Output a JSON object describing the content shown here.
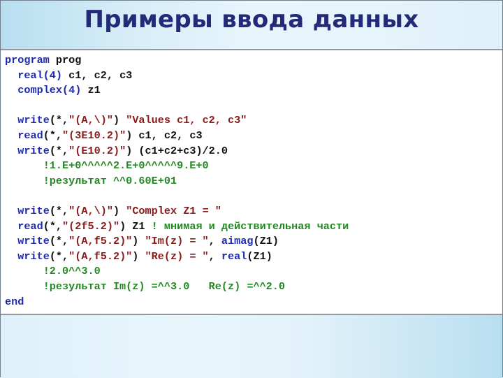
{
  "slide": {
    "title": "Примеры ввода данных"
  },
  "colors": {
    "title": "#232a78",
    "keyword": "#1f2ab0",
    "string": "#8b1a1a",
    "comment": "#238a23",
    "plain": "#111111"
  },
  "code": {
    "lines": [
      [
        {
          "t": "kw",
          "s": "program"
        },
        {
          "t": "plain",
          "s": " prog"
        }
      ],
      [
        {
          "t": "plain",
          "s": "  "
        },
        {
          "t": "kw",
          "s": "real(4)"
        },
        {
          "t": "plain",
          "s": " c1, c2, c3"
        }
      ],
      [
        {
          "t": "plain",
          "s": "  "
        },
        {
          "t": "kw",
          "s": "complex(4)"
        },
        {
          "t": "plain",
          "s": " z1"
        }
      ],
      [],
      [
        {
          "t": "plain",
          "s": "  "
        },
        {
          "t": "kw",
          "s": "write"
        },
        {
          "t": "plain",
          "s": "(*,"
        },
        {
          "t": "str",
          "s": "\"(A,\\)\""
        },
        {
          "t": "plain",
          "s": ") "
        },
        {
          "t": "str",
          "s": "\"Values c1, c2, c3\""
        }
      ],
      [
        {
          "t": "plain",
          "s": "  "
        },
        {
          "t": "kw",
          "s": "read"
        },
        {
          "t": "plain",
          "s": "(*,"
        },
        {
          "t": "str",
          "s": "\"(3E10.2)\""
        },
        {
          "t": "plain",
          "s": ") c1, c2, c3"
        }
      ],
      [
        {
          "t": "plain",
          "s": "  "
        },
        {
          "t": "kw",
          "s": "write"
        },
        {
          "t": "plain",
          "s": "(*,"
        },
        {
          "t": "str",
          "s": "\"(E10.2)\""
        },
        {
          "t": "plain",
          "s": ") (c1+c2+c3)/2.0"
        }
      ],
      [
        {
          "t": "plain",
          "s": "      "
        },
        {
          "t": "cmt",
          "s": "!1.E+0^^^^^2.E+0^^^^^9.E+0"
        }
      ],
      [
        {
          "t": "plain",
          "s": "      "
        },
        {
          "t": "cmt",
          "s": "!результат ^^0.60E+01"
        }
      ],
      [],
      [
        {
          "t": "plain",
          "s": "  "
        },
        {
          "t": "kw",
          "s": "write"
        },
        {
          "t": "plain",
          "s": "(*,"
        },
        {
          "t": "str",
          "s": "\"(A,\\)\""
        },
        {
          "t": "plain",
          "s": ") "
        },
        {
          "t": "str",
          "s": "\"Complex Z1 = \""
        }
      ],
      [
        {
          "t": "plain",
          "s": "  "
        },
        {
          "t": "kw",
          "s": "read"
        },
        {
          "t": "plain",
          "s": "(*,"
        },
        {
          "t": "str",
          "s": "\"(2f5.2)\""
        },
        {
          "t": "plain",
          "s": ") Z1 "
        },
        {
          "t": "cmt",
          "s": "! мнимая и действительная части"
        }
      ],
      [
        {
          "t": "plain",
          "s": "  "
        },
        {
          "t": "kw",
          "s": "write"
        },
        {
          "t": "plain",
          "s": "(*,"
        },
        {
          "t": "str",
          "s": "\"(A,f5.2)\""
        },
        {
          "t": "plain",
          "s": ") "
        },
        {
          "t": "str",
          "s": "\"Im(z) = \""
        },
        {
          "t": "plain",
          "s": ", "
        },
        {
          "t": "kw",
          "s": "aimag"
        },
        {
          "t": "plain",
          "s": "(Z1)"
        }
      ],
      [
        {
          "t": "plain",
          "s": "  "
        },
        {
          "t": "kw",
          "s": "write"
        },
        {
          "t": "plain",
          "s": "(*,"
        },
        {
          "t": "str",
          "s": "\"(A,f5.2)\""
        },
        {
          "t": "plain",
          "s": ") "
        },
        {
          "t": "str",
          "s": "\"Re(z) = \""
        },
        {
          "t": "plain",
          "s": ", "
        },
        {
          "t": "kw",
          "s": "real"
        },
        {
          "t": "plain",
          "s": "(Z1)"
        }
      ],
      [
        {
          "t": "plain",
          "s": "      "
        },
        {
          "t": "cmt",
          "s": "!2.0^^3.0"
        }
      ],
      [
        {
          "t": "plain",
          "s": "      "
        },
        {
          "t": "cmt",
          "s": "!результат Im(z) =^^3.0   Re(z) =^^2.0"
        }
      ],
      [
        {
          "t": "kw",
          "s": "end"
        }
      ]
    ]
  }
}
